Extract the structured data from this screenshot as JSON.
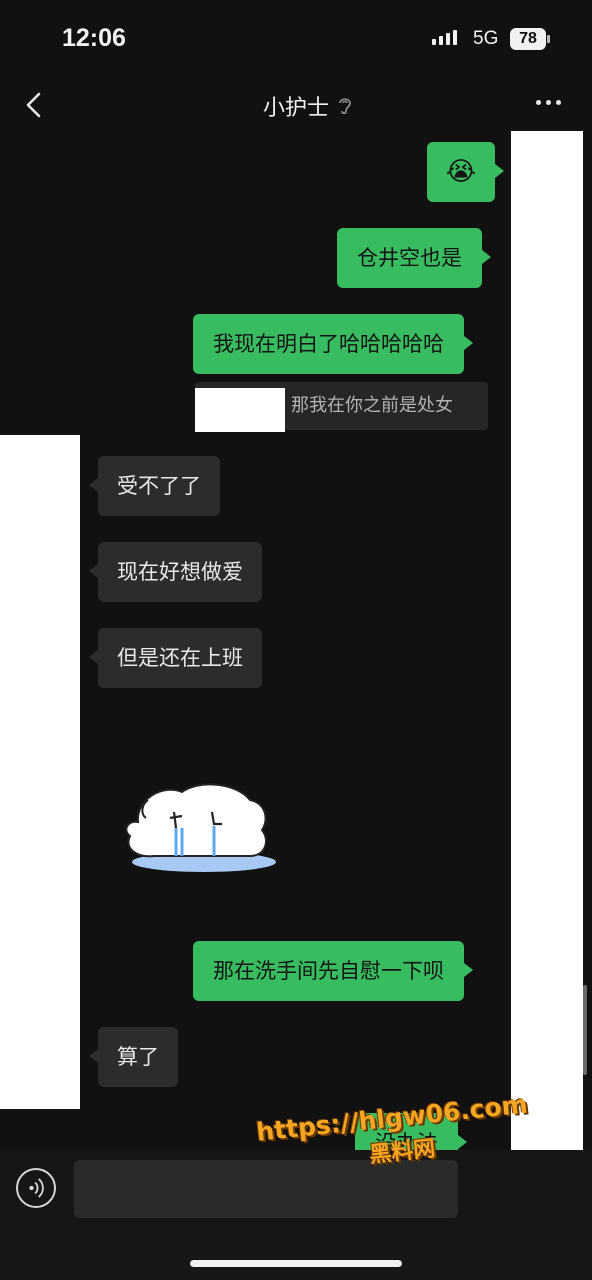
{
  "status_bar": {
    "time": "12:06",
    "network": "5G",
    "battery": "78"
  },
  "nav": {
    "title": "小护士",
    "back_icon": "chevron-left-icon",
    "ear_icon": "ear-icon",
    "more_icon": "more-dots-icon"
  },
  "messages": [
    {
      "side": "out",
      "type": "emoji",
      "text": "😭"
    },
    {
      "side": "out",
      "type": "text",
      "text": "仓井空也是"
    },
    {
      "side": "out",
      "type": "text",
      "text": "我现在明白了哈哈哈哈哈",
      "quote": "那我在你之前是处女"
    },
    {
      "side": "in",
      "type": "text",
      "text": "受不了了"
    },
    {
      "side": "in",
      "type": "text",
      "text": "现在好想做爱"
    },
    {
      "side": "in",
      "type": "text",
      "text": "但是还在上班"
    },
    {
      "side": "in",
      "type": "sticker",
      "text": "crying-dog-sticker"
    },
    {
      "side": "out",
      "type": "text",
      "text": "那在洗手间先自慰一下呗"
    },
    {
      "side": "in",
      "type": "text",
      "text": "算了"
    },
    {
      "side": "out",
      "type": "text",
      "text": "没办法"
    }
  ],
  "input_bar": {
    "voice_icon": "voice-icon"
  },
  "watermark": {
    "url": "https://hlgw06.com",
    "name": "黑料网"
  },
  "colors": {
    "outgoing": "#37bd5f",
    "incoming": "#2c2c2c",
    "background": "#111111"
  }
}
